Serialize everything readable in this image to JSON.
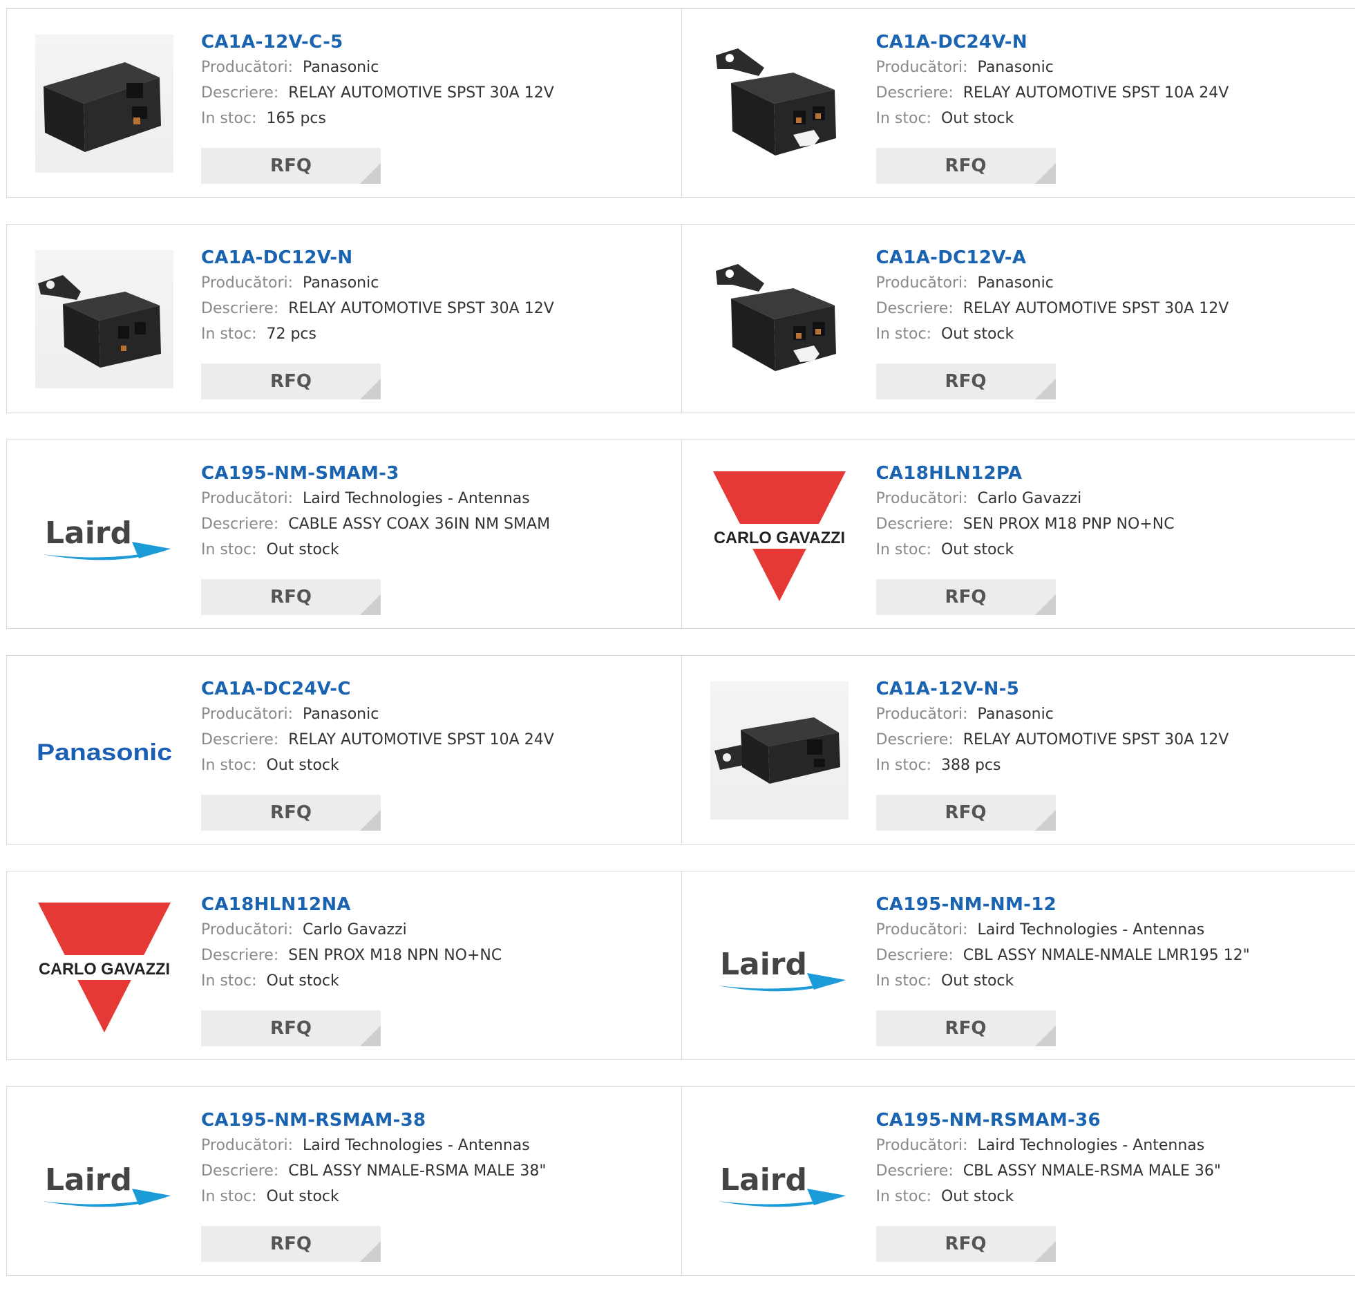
{
  "labels": {
    "manufacturer": "Producători:",
    "description": "Descriere:",
    "stock": "In stoc:",
    "rfq": "RFQ"
  },
  "products": [
    {
      "part": "CA1A-12V-C-5",
      "manufacturer": "Panasonic",
      "description": "RELAY AUTOMOTIVE SPST 30A 12V",
      "stock": "165 pcs",
      "image": "relay-box-icon"
    },
    {
      "part": "CA1A-DC24V-N",
      "manufacturer": "Panasonic",
      "description": "RELAY AUTOMOTIVE SPST 10A 24V",
      "stock": "Out stock",
      "image": "relay-bracket-icon"
    },
    {
      "part": "CA1A-DC12V-N",
      "manufacturer": "Panasonic",
      "description": "RELAY AUTOMOTIVE SPST 30A 12V",
      "stock": "72 pcs",
      "image": "relay-bracket-side-icon"
    },
    {
      "part": "CA1A-DC12V-A",
      "manufacturer": "Panasonic",
      "description": "RELAY AUTOMOTIVE SPST 30A 12V",
      "stock": "Out stock",
      "image": "relay-bracket-icon"
    },
    {
      "part": "CA195-NM-SMAM-3",
      "manufacturer": "Laird Technologies - Antennas",
      "description": "CABLE ASSY COAX 36IN NM SMAM",
      "stock": "Out stock",
      "image": "laird-logo"
    },
    {
      "part": "CA18HLN12PA",
      "manufacturer": "Carlo Gavazzi",
      "description": "SEN PROX M18 PNP NO+NC",
      "stock": "Out stock",
      "image": "carlo-gavazzi-logo"
    },
    {
      "part": "CA1A-DC24V-C",
      "manufacturer": "Panasonic",
      "description": "RELAY AUTOMOTIVE SPST 10A 24V",
      "stock": "Out stock",
      "image": "panasonic-logo"
    },
    {
      "part": "CA1A-12V-N-5",
      "manufacturer": "Panasonic",
      "description": "RELAY AUTOMOTIVE SPST 30A 12V",
      "stock": "388 pcs",
      "image": "relay-flat-bracket-icon"
    },
    {
      "part": "CA18HLN12NA",
      "manufacturer": "Carlo Gavazzi",
      "description": "SEN PROX M18 NPN NO+NC",
      "stock": "Out stock",
      "image": "carlo-gavazzi-logo"
    },
    {
      "part": "CA195-NM-NM-12",
      "manufacturer": "Laird Technologies - Antennas",
      "description": "CBL ASSY NMALE-NMALE LMR195 12\"",
      "stock": "Out stock",
      "image": "laird-logo"
    },
    {
      "part": "CA195-NM-RSMAM-38",
      "manufacturer": "Laird Technologies - Antennas",
      "description": "CBL ASSY NMALE-RSMA MALE 38\"",
      "stock": "Out stock",
      "image": "laird-logo"
    },
    {
      "part": "CA195-NM-RSMAM-36",
      "manufacturer": "Laird Technologies - Antennas",
      "description": "CBL ASSY NMALE-RSMA MALE 36\"",
      "stock": "Out stock",
      "image": "laird-logo"
    }
  ],
  "logos": {
    "laird": "Laird",
    "panasonic": "Panasonic",
    "carlo_gavazzi": "CARLO GAVAZZI"
  },
  "colors": {
    "title": "#1a63b0",
    "label": "#8a8a8a",
    "rfq_bg": "#ececec",
    "laird_blue": "#1b9bd7",
    "gavazzi_red": "#e53935",
    "panasonic_blue": "#1b5fb4"
  }
}
